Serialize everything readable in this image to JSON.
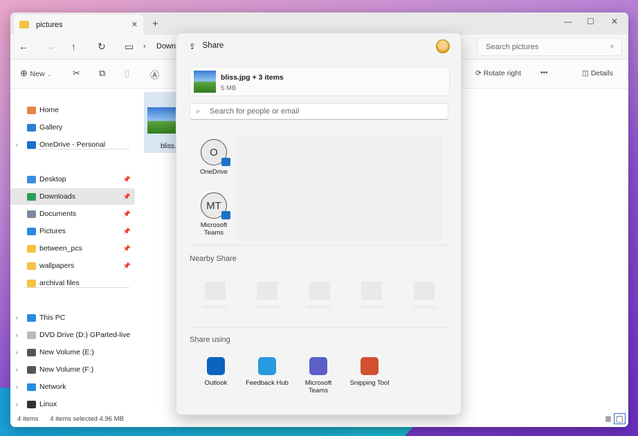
{
  "window": {
    "tab_title": "pictures",
    "new_tab": "+",
    "minimize": "—",
    "maximize": "☐",
    "close": "✕"
  },
  "nav": {
    "breadcrumb": "Down",
    "search_placeholder": "Search pictures"
  },
  "toolbar": {
    "new_label": "New",
    "rotate_right": "Rotate right",
    "more": "•••",
    "details": "Details"
  },
  "sidebar": {
    "items": [
      {
        "label": "Home",
        "icon": "home-icon",
        "color": "#e8834a"
      },
      {
        "label": "Gallery",
        "icon": "gallery-icon",
        "color": "#2a7fd4"
      },
      {
        "label": "OneDrive - Personal",
        "icon": "onedrive-icon",
        "color": "#1a6fd0",
        "chevron": true
      },
      {
        "label": "Desktop",
        "icon": "desktop-icon",
        "color": "#3a8ee0",
        "pin": true
      },
      {
        "label": "Downloads",
        "icon": "downloads-icon",
        "color": "#2aa05a",
        "pin": true,
        "selected": true
      },
      {
        "label": "Documents",
        "icon": "documents-icon",
        "color": "#7a8aa0",
        "pin": true
      },
      {
        "label": "Pictures",
        "icon": "pictures-icon",
        "color": "#2a8ae0",
        "pin": true
      },
      {
        "label": "between_pcs",
        "icon": "folder-icon",
        "color": "#f5c242",
        "pin": true
      },
      {
        "label": "wallpapers",
        "icon": "folder-icon",
        "color": "#f5c242",
        "pin": true
      },
      {
        "label": "archival files",
        "icon": "folder-icon",
        "color": "#f5c242"
      },
      {
        "label": "This PC",
        "icon": "pc-icon",
        "color": "#2a8ae0",
        "chevron": true
      },
      {
        "label": "DVD Drive (D:) GParted-live",
        "icon": "dvd-icon",
        "color": "#bbbbbb",
        "chevron": true
      },
      {
        "label": "New Volume (E:)",
        "icon": "drive-icon",
        "color": "#555555",
        "chevron": true
      },
      {
        "label": "New Volume (F:)",
        "icon": "drive-icon",
        "color": "#555555",
        "chevron": true
      },
      {
        "label": "Network",
        "icon": "network-icon",
        "color": "#2a8ae0",
        "chevron": true
      },
      {
        "label": "Linux",
        "icon": "linux-icon",
        "color": "#333333",
        "chevron": true
      }
    ]
  },
  "content": {
    "file_label": "bliss.j"
  },
  "status": {
    "count": "4 items",
    "selected": "4 items selected  4.96 MB"
  },
  "share": {
    "title": "Share",
    "file_name": "bliss.jpg + 3 items",
    "file_size": "5 MB",
    "search_placeholder": "Search for people or email",
    "contacts": [
      {
        "initials": "O",
        "name": "OneDrive"
      },
      {
        "initials": "MT",
        "name": "Microsoft Teams"
      }
    ],
    "nearby_title": "Nearby Share",
    "share_using_title": "Share using",
    "apps": [
      {
        "name": "Outlook",
        "icon": "outlook-icon",
        "color": "#0a64c0"
      },
      {
        "name": "Feedback Hub",
        "icon": "feedback-hub-icon",
        "color": "#2a9ae0"
      },
      {
        "name": "Microsoft Teams",
        "icon": "teams-icon",
        "color": "#5b5fc7"
      },
      {
        "name": "Snipping Tool",
        "icon": "snipping-tool-icon",
        "color": "#d05030"
      }
    ]
  }
}
